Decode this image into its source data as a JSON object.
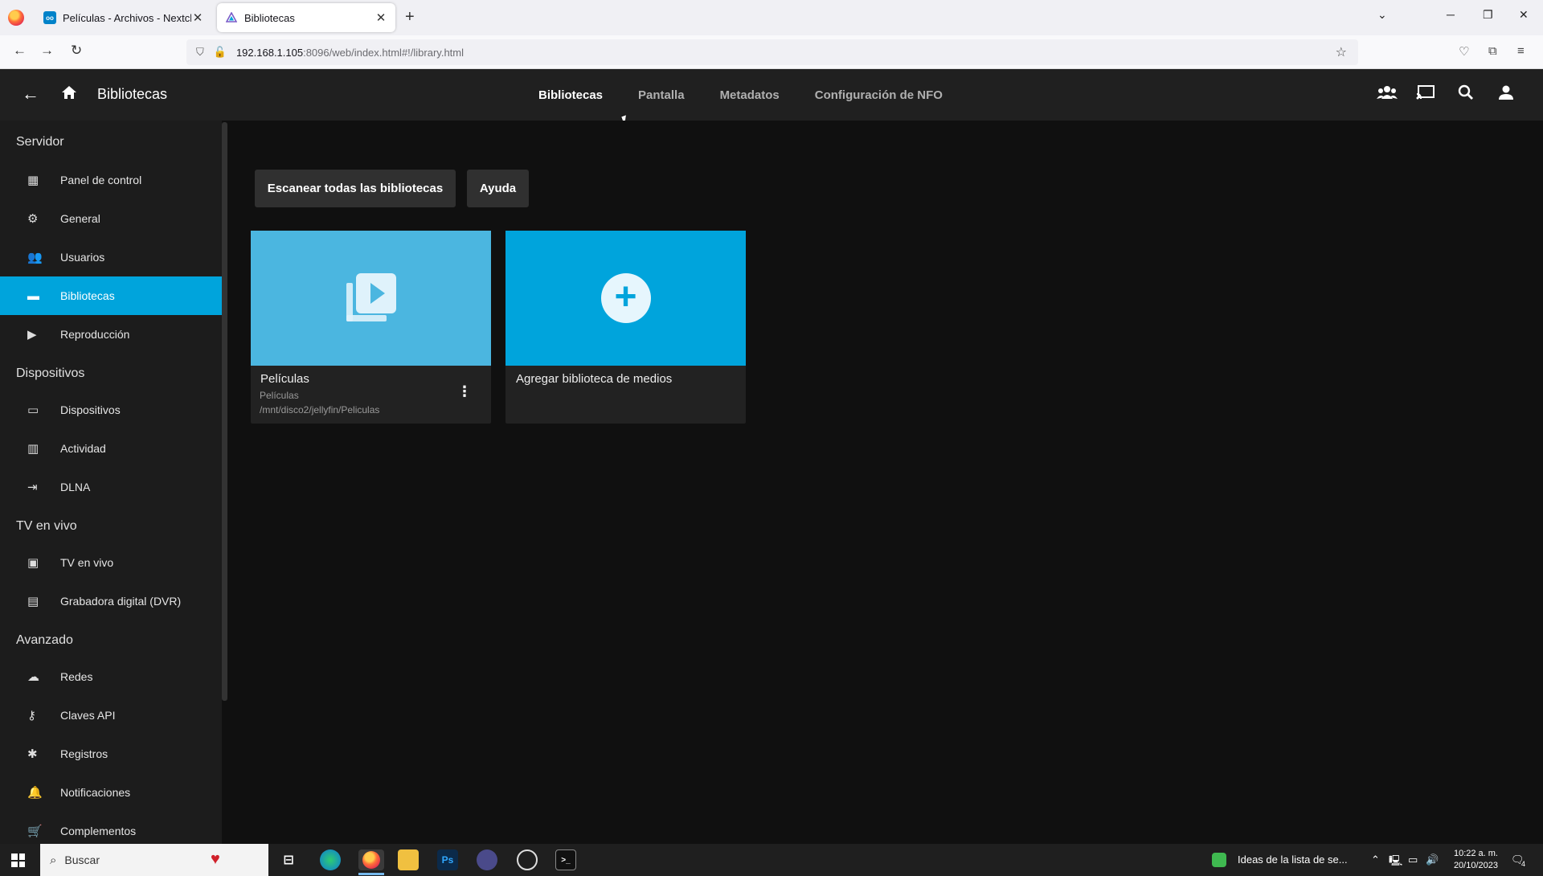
{
  "browser": {
    "tabs": [
      {
        "title": "Películas - Archivos - Nextcloud",
        "active": false
      },
      {
        "title": "Bibliotecas",
        "active": true
      }
    ],
    "url": {
      "host": "192.168.1.105",
      "rest": ":8096/web/index.html#!/library.html"
    }
  },
  "header": {
    "title": "Bibliotecas",
    "tabs": [
      "Bibliotecas",
      "Pantalla",
      "Metadatos",
      "Configuración de NFO"
    ]
  },
  "sidebar": {
    "sections": [
      {
        "title": "Servidor",
        "items": [
          {
            "label": "Panel de control",
            "icon": "dashboard-icon",
            "glyph": "▦"
          },
          {
            "label": "General",
            "icon": "gear-icon",
            "glyph": "⚙"
          },
          {
            "label": "Usuarios",
            "icon": "users-icon",
            "glyph": "👥"
          },
          {
            "label": "Bibliotecas",
            "icon": "folder-icon",
            "glyph": "▬"
          },
          {
            "label": "Reproducción",
            "icon": "play-icon",
            "glyph": "▶"
          }
        ]
      },
      {
        "title": "Dispositivos",
        "items": [
          {
            "label": "Dispositivos",
            "icon": "devices-icon",
            "glyph": "▭"
          },
          {
            "label": "Actividad",
            "icon": "activity-icon",
            "glyph": "▥"
          },
          {
            "label": "DLNA",
            "icon": "dlna-icon",
            "glyph": "⇥"
          }
        ]
      },
      {
        "title": "TV en vivo",
        "items": [
          {
            "label": "TV en vivo",
            "icon": "tv-icon",
            "glyph": "▣"
          },
          {
            "label": "Grabadora digital (DVR)",
            "icon": "dvr-icon",
            "glyph": "▤"
          }
        ]
      },
      {
        "title": "Avanzado",
        "items": [
          {
            "label": "Redes",
            "icon": "cloud-icon",
            "glyph": "☁"
          },
          {
            "label": "Claves API",
            "icon": "key-icon",
            "glyph": "⚷"
          },
          {
            "label": "Registros",
            "icon": "bug-icon",
            "glyph": "✱"
          },
          {
            "label": "Notificaciones",
            "icon": "bell-icon",
            "glyph": "🔔"
          },
          {
            "label": "Complementos",
            "icon": "cart-icon",
            "glyph": "🛒"
          }
        ]
      }
    ],
    "active": "Bibliotecas"
  },
  "main": {
    "scan_button": "Escanear todas las bibliotecas",
    "help_button": "Ayuda",
    "libraries": [
      {
        "name": "Películas",
        "type": "Películas",
        "path": "/mnt/disco2/jellyfin/Peliculas"
      }
    ],
    "add_library": "Agregar biblioteca de medios"
  },
  "taskbar": {
    "search_placeholder": "Buscar",
    "tray_news": "Ideas de la lista de se...",
    "time": "10:22 a. m.",
    "date": "20/10/2023",
    "notification_count": "4"
  },
  "colors": {
    "accent": "#00a4dc",
    "library_card": "#4bb6e0",
    "header": "#202020",
    "sidebar": "#1c1c1c",
    "background": "#101010"
  }
}
